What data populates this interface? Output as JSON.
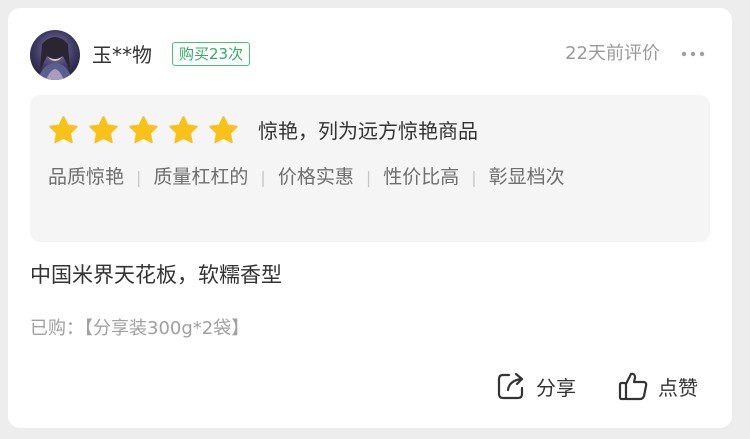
{
  "review": {
    "user": {
      "name": "玉**物",
      "avatar_icon": "user-avatar-icon",
      "purchase_badge": "购买23次"
    },
    "time": "22天前评价",
    "more_icon": "more-dots-icon",
    "rating": {
      "stars": 5,
      "max_stars": 5,
      "star_color": "#f9c21b",
      "text": "惊艳，列为远方惊艳商品"
    },
    "tags": [
      "品质惊艳",
      "质量杠杠的",
      "价格实惠",
      "性价比高",
      "彰显档次"
    ],
    "tag_separator": "|",
    "content": "中国米界天花板，软糯香型",
    "purchased": "已购：【分享装300g*2袋】",
    "actions": {
      "share_label": "分享",
      "share_icon": "share-icon",
      "like_label": "点赞",
      "like_icon": "thumbs-up-icon"
    }
  },
  "colors": {
    "badge": "#2fae62",
    "rating_box": "#f5f5f5",
    "page_background": "#ededed"
  }
}
